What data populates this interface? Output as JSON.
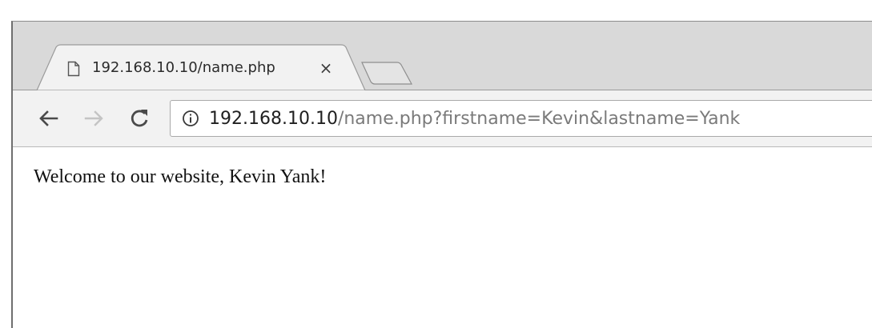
{
  "browser": {
    "tab": {
      "title": "192.168.10.10/name.php",
      "close_symbol": "×",
      "favicon": "page-icon"
    },
    "new_tab_icon": "new-tab-icon",
    "toolbar": {
      "back_icon": "back-arrow-icon",
      "forward_icon": "forward-arrow-icon",
      "reload_icon": "reload-icon"
    },
    "address_bar": {
      "security_icon": "info-icon",
      "host": "192.168.10.10",
      "path": "/name.php?firstname=Kevin&lastname=Yank"
    }
  },
  "page": {
    "text": "Welcome to our website, Kevin Yank!"
  },
  "colors": {
    "tab_strip": "#d9d9d9",
    "toolbar": "#f2f2f2",
    "host_text": "#1f1f1f",
    "path_text": "#7a7a7a"
  }
}
